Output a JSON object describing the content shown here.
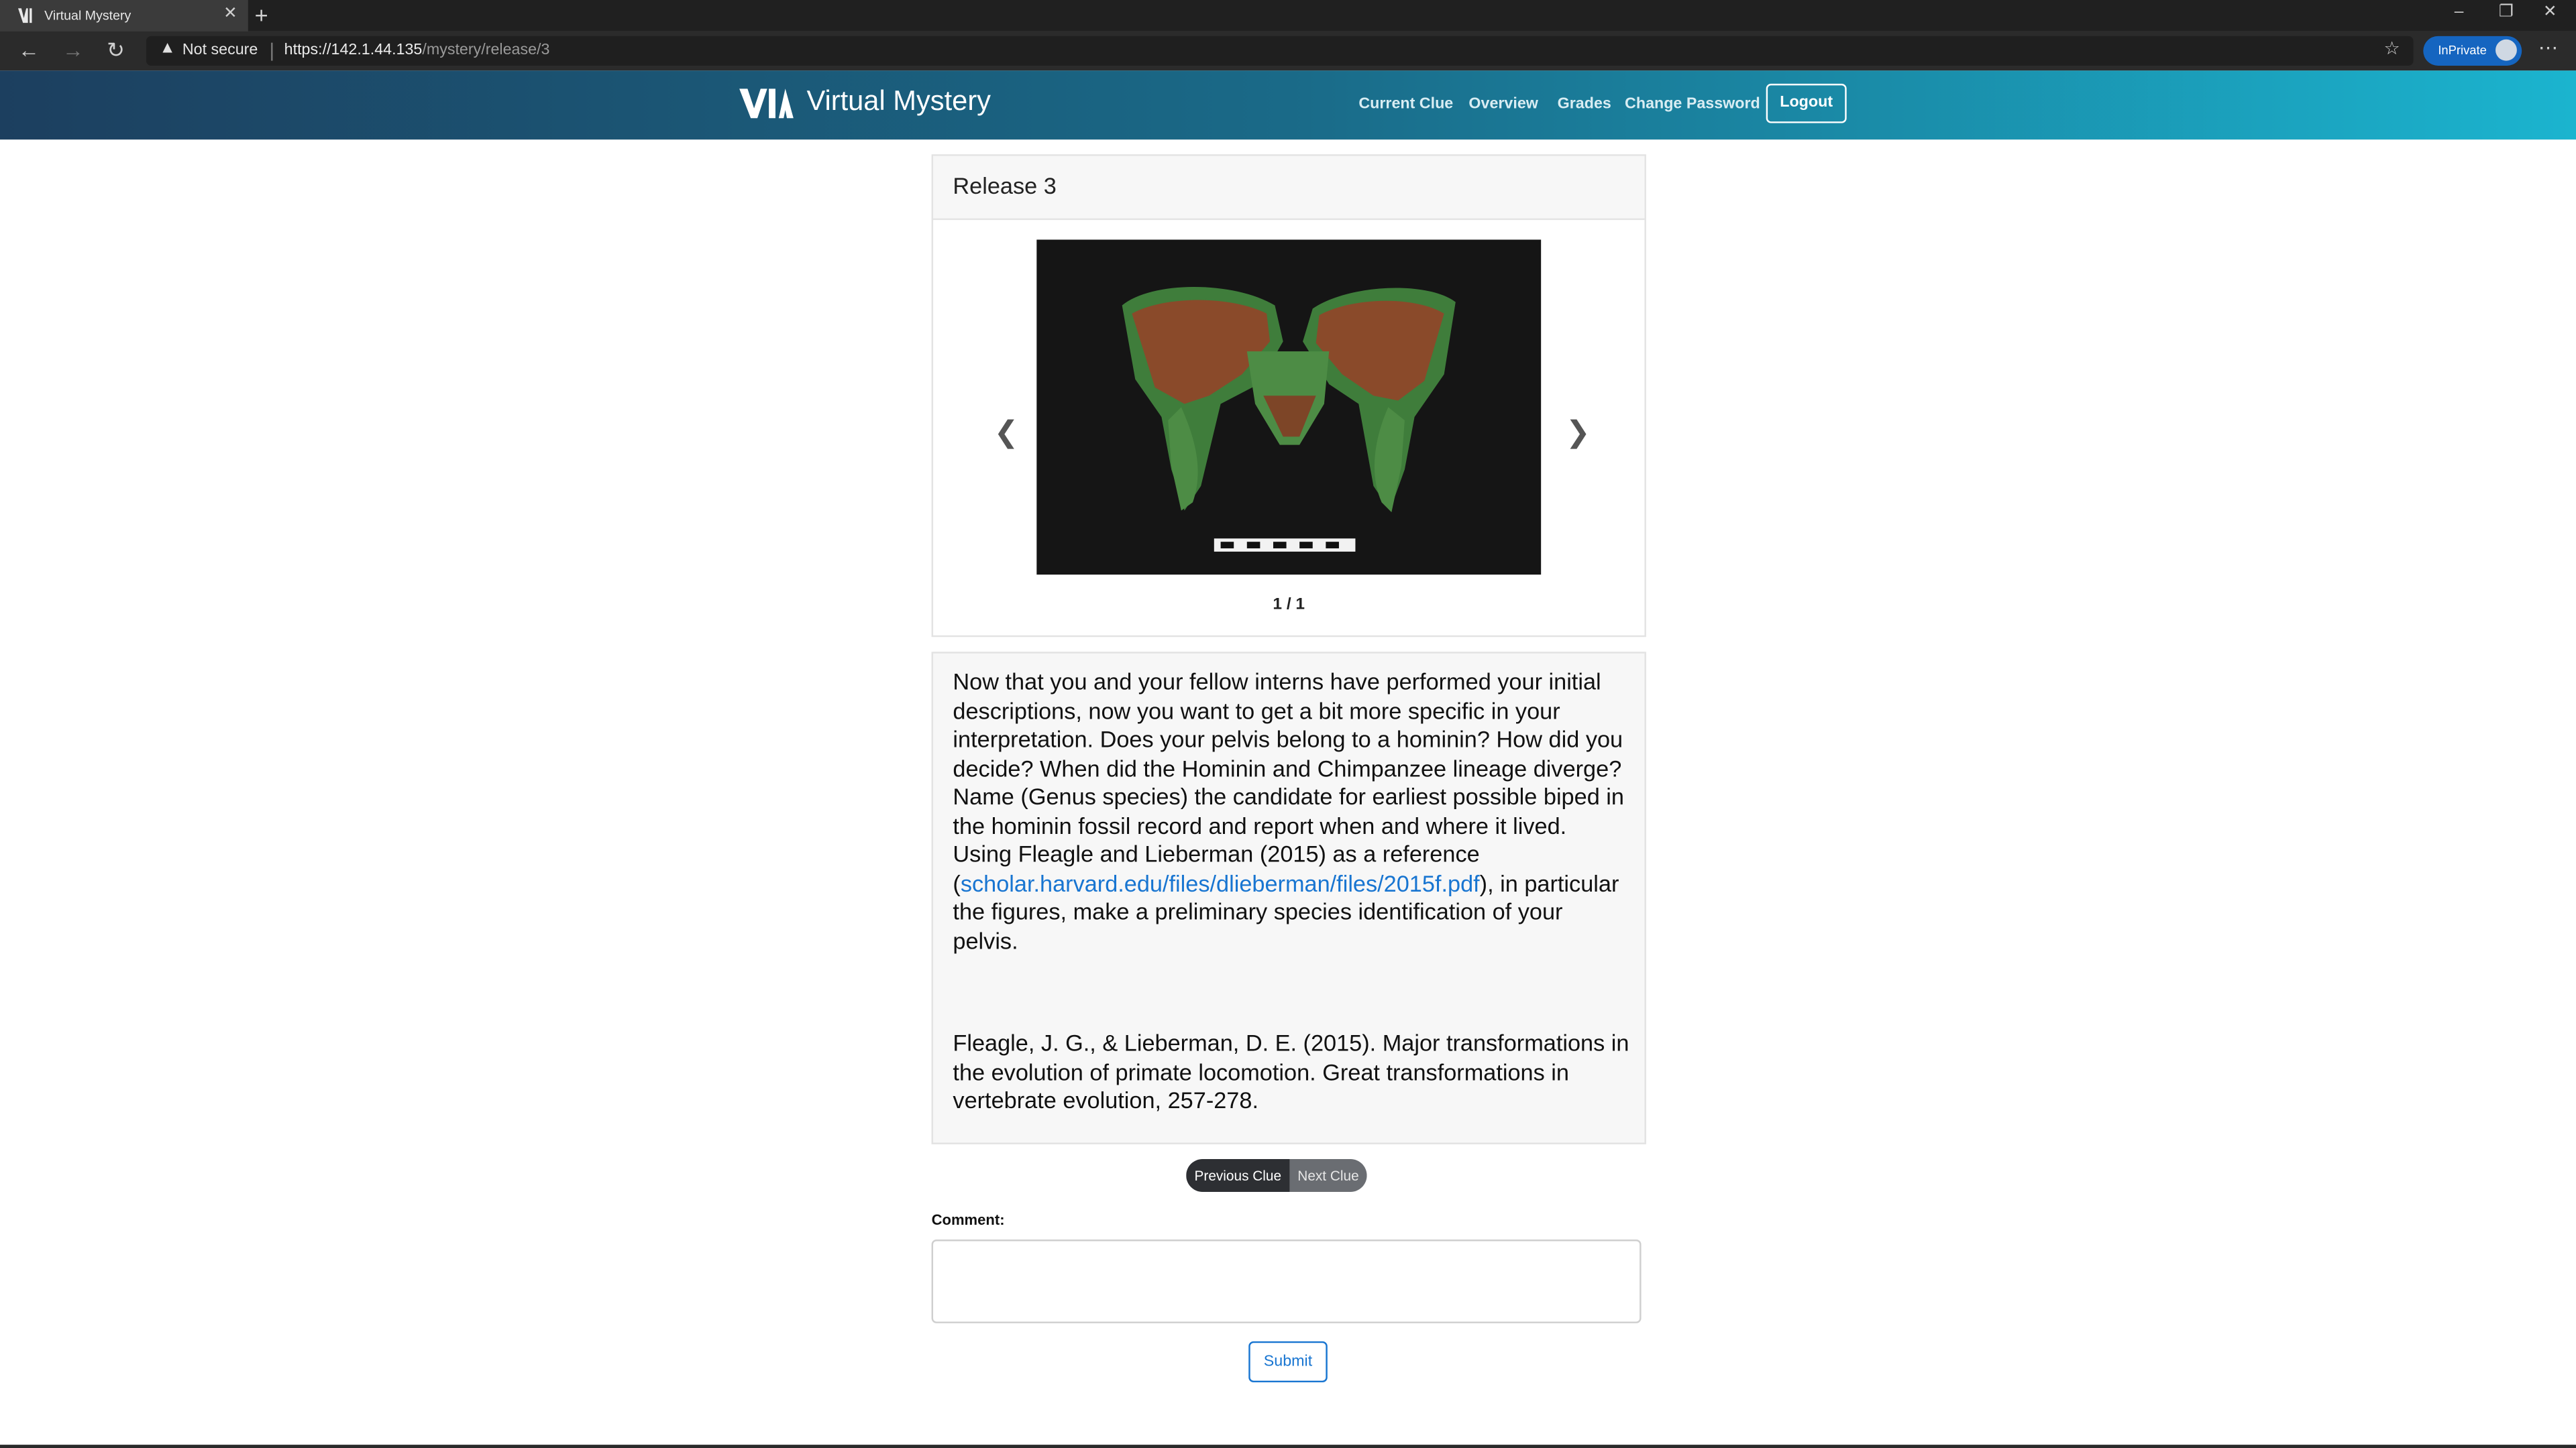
{
  "browser": {
    "tab_title": "Virtual Mystery",
    "not_secure": "Not secure",
    "url_scheme_host": "https://142.1.44.135",
    "url_path": "/mystery/release/3",
    "inprivate": "InPrivate"
  },
  "header": {
    "brand": "Virtual Mystery",
    "nav": [
      "Current Clue",
      "Overview",
      "Grades",
      "Change Password"
    ],
    "logout": "Logout"
  },
  "release": {
    "title": "Release 3",
    "counter": "1 / 1"
  },
  "clue": {
    "text_before_link": "Now that you and your fellow interns have performed your initial descriptions, now you want to get a bit more specific in your interpretation. Does your pelvis belong to a hominin? How did you decide? When did the Hominin and Chimpanzee lineage diverge? Name (Genus species) the candidate for earliest possible biped in the hominin fossil record and report when and where it lived.",
    "ref_intro": "Using Fleagle and Lieberman (2015) as a reference (",
    "link": "scholar.harvard.edu/files/dlieberman/files/2015f.pdf",
    "text_after_link": "), in particular the figures, make a preliminary species identification of your pelvis.",
    "reference": "Fleagle, J. G., & Lieberman, D. E. (2015). Major transformations in the evolution of primate locomotion. Great transformations in vertebrate evolution, 257-278."
  },
  "clue_nav": {
    "previous": "Previous Clue",
    "next": "Next Clue"
  },
  "comment": {
    "label": "Comment:",
    "value": ""
  },
  "submit": "Submit",
  "colors": {
    "header_gradient_start": "#1c3f5f",
    "header_gradient_end": "#1bb4cf",
    "link": "#1875d1",
    "prev_button": "#2d2f33",
    "next_button": "#6a6d72"
  }
}
